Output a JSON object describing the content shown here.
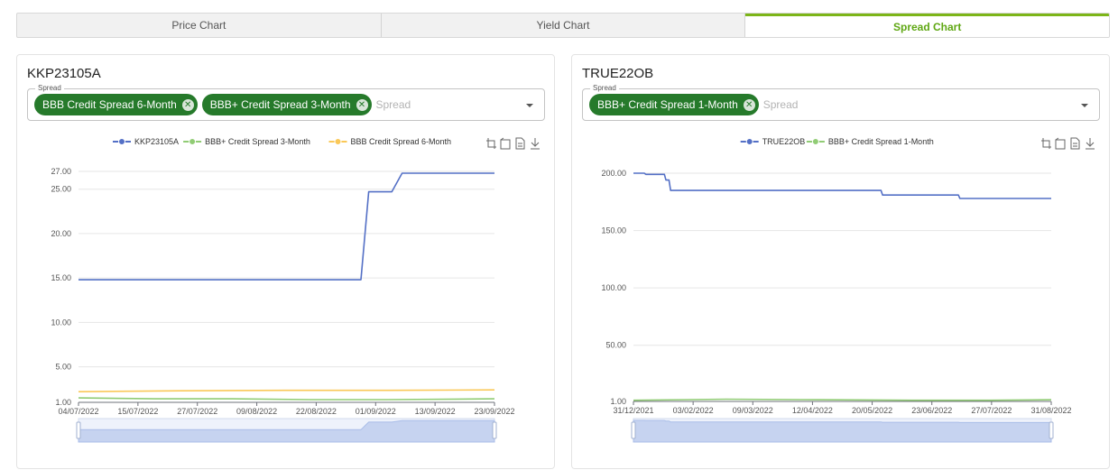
{
  "tabs": [
    {
      "label": "Price Chart",
      "active": false
    },
    {
      "label": "Yield Chart",
      "active": false
    },
    {
      "label": "Spread Chart",
      "active": true
    }
  ],
  "toolbox_icons": [
    "zoom-icon",
    "zoom-reset-icon",
    "data-view-icon",
    "download-icon"
  ],
  "panels": [
    {
      "title": "KKP23105A",
      "spread_label": "Spread",
      "placeholder": "Spread",
      "chips": [
        "BBB Credit Spread 6-Month",
        "BBB+ Credit Spread 3-Month"
      ]
    },
    {
      "title": "TRUE22OB",
      "spread_label": "Spread",
      "placeholder": "Spread",
      "chips": [
        "BBB+ Credit Spread 1-Month"
      ]
    }
  ],
  "chart_data": [
    {
      "type": "line",
      "legend_position": "top-center",
      "grid": true,
      "x_tick_labels": [
        "04/07/2022",
        "15/07/2022",
        "27/07/2022",
        "09/08/2022",
        "22/08/2022",
        "01/09/2022",
        "13/09/2022",
        "23/09/2022"
      ],
      "y_tick_labels": [
        "1.00",
        "5.00",
        "10.00",
        "15.00",
        "20.00",
        "25.00",
        "27.00"
      ],
      "ylim": [
        1,
        27
      ],
      "x_range": [
        0,
        81
      ],
      "series": [
        {
          "name": "KKP23105A",
          "color": "#5470c6",
          "points": [
            [
              0,
              14.8
            ],
            [
              55,
              14.8
            ],
            [
              56.5,
              24.7
            ],
            [
              61,
              24.7
            ],
            [
              63,
              26.8
            ],
            [
              81,
              26.8
            ]
          ]
        },
        {
          "name": "BBB+ Credit Spread 3-Month",
          "color": "#91cc75",
          "points": [
            [
              0,
              1.5
            ],
            [
              15,
              1.4
            ],
            [
              30,
              1.4
            ],
            [
              45,
              1.3
            ],
            [
              60,
              1.3
            ],
            [
              81,
              1.4
            ]
          ]
        },
        {
          "name": "BBB Credit Spread 6-Month",
          "color": "#fac858",
          "points": [
            [
              0,
              2.2
            ],
            [
              20,
              2.3
            ],
            [
              40,
              2.35
            ],
            [
              60,
              2.35
            ],
            [
              81,
              2.4
            ]
          ]
        }
      ]
    },
    {
      "type": "line",
      "legend_position": "top-center",
      "grid": true,
      "x_tick_labels": [
        "31/12/2021",
        "03/02/2022",
        "09/03/2022",
        "12/04/2022",
        "20/05/2022",
        "23/06/2022",
        "27/07/2022",
        "31/08/2022"
      ],
      "y_tick_labels": [
        "1.00",
        "50.00",
        "100.00",
        "150.00",
        "200.00"
      ],
      "ylim": [
        1,
        200
      ],
      "x_range": [
        0,
        270
      ],
      "series": [
        {
          "name": "TRUE22OB",
          "color": "#5470c6",
          "points": [
            [
              0,
              200
            ],
            [
              7,
              200
            ],
            [
              8,
              199
            ],
            [
              20,
              199
            ],
            [
              21,
              194
            ],
            [
              23,
              194
            ],
            [
              24,
              185
            ],
            [
              160,
              185
            ],
            [
              161,
              181
            ],
            [
              210,
              181
            ],
            [
              211,
              178
            ],
            [
              270,
              178
            ]
          ]
        },
        {
          "name": "BBB+ Credit Spread 1-Month",
          "color": "#91cc75",
          "points": [
            [
              0,
              2
            ],
            [
              60,
              3
            ],
            [
              120,
              2.5
            ],
            [
              180,
              2
            ],
            [
              230,
              2
            ],
            [
              270,
              2.5
            ]
          ]
        }
      ]
    }
  ]
}
